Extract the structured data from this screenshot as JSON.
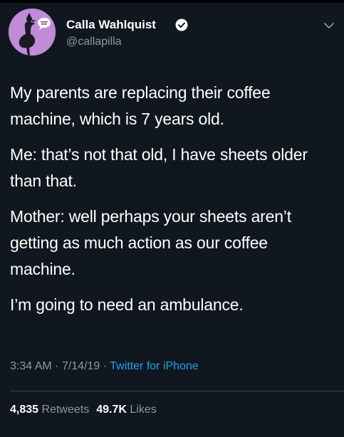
{
  "author": {
    "display_name": "Calla Wahlquist",
    "handle": "@callapilla",
    "verified": true,
    "avatar_icon": "cassowary-avatar-icon",
    "avatar_bg": "#c08bd8"
  },
  "tweet": {
    "paragraphs": [
      "My parents are replacing their coffee machine, which is 7 years old.",
      "Me: that’s not that old, I have sheets older than that.",
      "Mother: well perhaps your sheets aren’t getting as much action as our coffee machine.",
      "I’m going to need an ambulance."
    ]
  },
  "meta": {
    "time": "3:34 AM",
    "date": "7/14/19",
    "separator": "·",
    "source": "Twitter for iPhone"
  },
  "stats": {
    "retweets_count": "4,835",
    "retweets_label": "Retweets",
    "likes_count": "49.7K",
    "likes_label": "Likes"
  },
  "colors": {
    "background": "#10171e",
    "text": "#ffffff",
    "muted": "#8899a6",
    "accent": "#1da1f2",
    "divider": "#38444d"
  }
}
